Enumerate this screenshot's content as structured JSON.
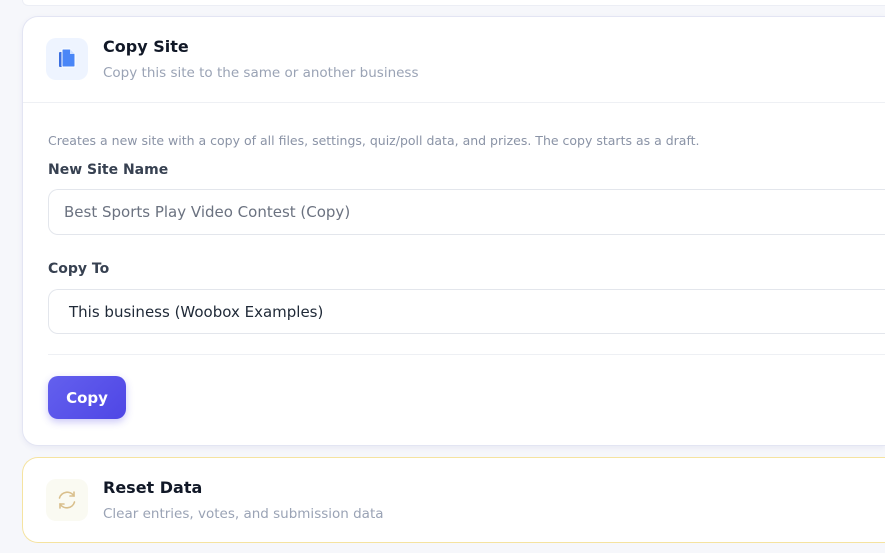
{
  "copy_site": {
    "title": "Copy Site",
    "subtitle": "Copy this site to the same or another business",
    "icon": "copy-icon",
    "description": "Creates a new site with a copy of all files, settings, quiz/poll data, and prizes. The copy starts as a draft.",
    "new_site_name_label": "New Site Name",
    "new_site_name_value": "Best Sports Play Video Contest (Copy)",
    "copy_to_label": "Copy To",
    "copy_to_value": "This business (Woobox Examples)",
    "copy_button": "Copy",
    "accent": "#4f46e5"
  },
  "reset_data": {
    "title": "Reset Data",
    "subtitle": "Clear entries, votes, and submission data",
    "icon": "refresh-icon",
    "border_color": "#f5e3a0"
  }
}
